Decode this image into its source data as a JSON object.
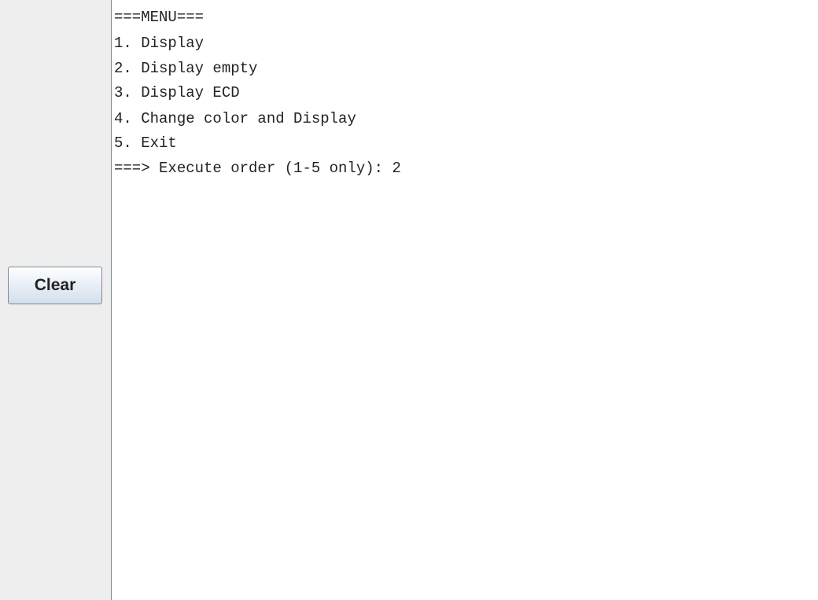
{
  "left_panel": {
    "clear_button_label": "Clear"
  },
  "console": {
    "lines": [
      "===MENU===",
      "1. Display",
      "2. Display empty",
      "3. Display ECD",
      "4. Change color and Display",
      "5. Exit",
      "===> Execute order (1-5 only): 2",
      "",
      "",
      "",
      "",
      "",
      "",
      "",
      "",
      "",
      "",
      "",
      "",
      "",
      "",
      "",
      ""
    ]
  }
}
